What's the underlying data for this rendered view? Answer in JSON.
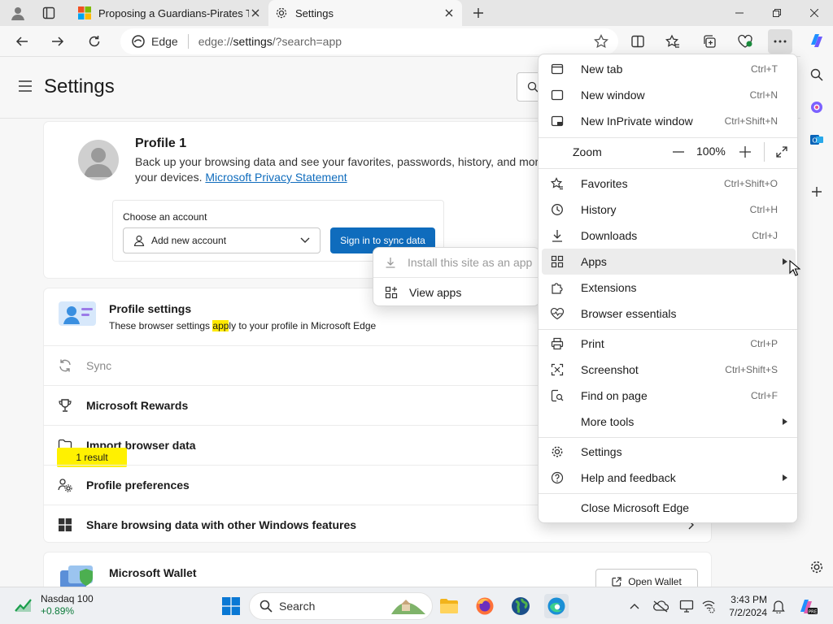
{
  "tabs": [
    {
      "title": "Proposing a Guardians-Pirates Tr",
      "active": false
    },
    {
      "title": "Settings",
      "active": true
    }
  ],
  "omnibox": {
    "site_label": "Edge",
    "url_prefix": "edge://",
    "url_host": "settings",
    "url_rest": "/?search=app"
  },
  "settings": {
    "title": "Settings",
    "profile": {
      "name": "Profile 1",
      "description": "Back up your browsing data and see your favorites, passwords, history, and more on all your devices.",
      "privacy_link": "Microsoft Privacy Statement",
      "choose_account_label": "Choose an account",
      "account_select_value": "Add new account",
      "signin_button": "Sign in to sync data"
    },
    "profile_settings": {
      "title": "Profile settings",
      "desc_before": "These browser settings ",
      "desc_highlight": "app",
      "desc_after": "ly to your profile in Microsoft Edge",
      "rows": [
        {
          "label": "Sync",
          "icon": "sync-icon",
          "disabled": true
        },
        {
          "label": "Microsoft Rewards",
          "icon": "trophy-icon",
          "disabled": false
        },
        {
          "label": "Import browser data",
          "icon": "folder-icon",
          "disabled": false
        },
        {
          "label": "Profile preferences",
          "icon": "people-settings-icon",
          "disabled": false
        },
        {
          "label": "Share browsing data with other Windows features",
          "icon": "windows-icon",
          "disabled": false
        }
      ],
      "result_badge": "1 result"
    },
    "wallet": {
      "title": "Microsoft Wallet",
      "button": "Open Wallet"
    }
  },
  "menu": {
    "new_tab": {
      "label": "New tab",
      "shortcut": "Ctrl+T"
    },
    "new_window": {
      "label": "New window",
      "shortcut": "Ctrl+N"
    },
    "new_inprivate": {
      "label": "New InPrivate window",
      "shortcut": "Ctrl+Shift+N"
    },
    "zoom": {
      "label": "Zoom",
      "value": "100%"
    },
    "favorites": {
      "label": "Favorites",
      "shortcut": "Ctrl+Shift+O"
    },
    "history": {
      "label": "History",
      "shortcut": "Ctrl+H"
    },
    "downloads": {
      "label": "Downloads",
      "shortcut": "Ctrl+J"
    },
    "apps": {
      "label": "Apps"
    },
    "extensions": {
      "label": "Extensions"
    },
    "browser_essentials": {
      "label": "Browser essentials"
    },
    "print": {
      "label": "Print",
      "shortcut": "Ctrl+P"
    },
    "screenshot": {
      "label": "Screenshot",
      "shortcut": "Ctrl+Shift+S"
    },
    "find": {
      "label": "Find on page",
      "shortcut": "Ctrl+F"
    },
    "more_tools": {
      "label": "More tools"
    },
    "settings": {
      "label": "Settings"
    },
    "help": {
      "label": "Help and feedback"
    },
    "close": {
      "label": "Close Microsoft Edge"
    }
  },
  "apps_submenu": {
    "install": {
      "label": "Install this site as an app",
      "disabled": true
    },
    "view": {
      "label": "View apps"
    }
  },
  "taskbar": {
    "stock_name": "Nasdaq 100",
    "stock_change": "+0.89%",
    "search_label": "Search",
    "time": "3:43 PM",
    "date": "7/2/2024"
  },
  "colors": {
    "accent": "#0f6cbd",
    "highlight": "#ffe900",
    "badge": "#fff100",
    "stock_up": "#0c7a3a"
  }
}
